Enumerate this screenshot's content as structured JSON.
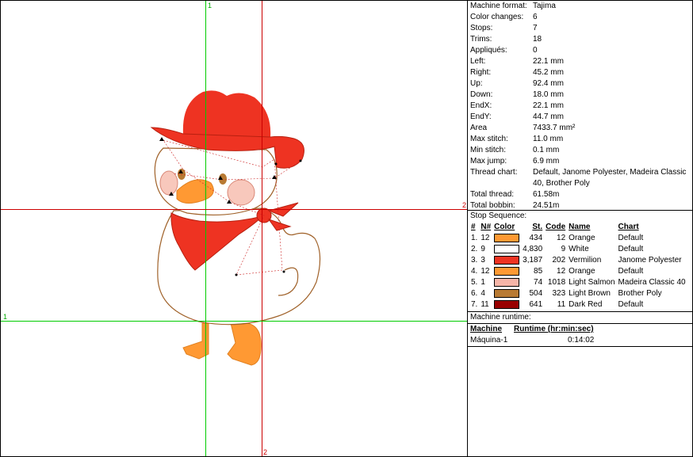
{
  "guides": {
    "v1_label": "1",
    "v2_label": "2",
    "h1_label": "1",
    "h2_label": "2"
  },
  "properties": [
    {
      "key": "Machine format:",
      "value": "Tajima"
    },
    {
      "key": "Color changes:",
      "value": "6"
    },
    {
      "key": "Stops:",
      "value": "7"
    },
    {
      "key": "Trims:",
      "value": "18"
    },
    {
      "key": "Appliqués:",
      "value": "0"
    },
    {
      "key": "Left:",
      "value": "22.1 mm"
    },
    {
      "key": "Right:",
      "value": "45.2 mm"
    },
    {
      "key": "Up:",
      "value": "92.4 mm"
    },
    {
      "key": "Down:",
      "value": "18.0 mm"
    },
    {
      "key": "EndX:",
      "value": "22.1 mm"
    },
    {
      "key": "EndY:",
      "value": "44.7 mm"
    },
    {
      "key": "Area",
      "value": "7433.7 mm²"
    },
    {
      "key": "Max stitch:",
      "value": "11.0 mm"
    },
    {
      "key": "Min stitch:",
      "value": "0.1 mm"
    },
    {
      "key": "Max jump:",
      "value": "6.9 mm"
    },
    {
      "key": "Thread chart:",
      "value": "Default, Janome Polyester, Madeira Classic 40, Brother Poly"
    },
    {
      "key": "Total thread:",
      "value": "61.58m"
    },
    {
      "key": "Total bobbin:",
      "value": "24.51m"
    }
  ],
  "stop_sequence": {
    "title": "Stop Sequence:",
    "headers": {
      "idx": "#",
      "n": "N#",
      "color": "Color",
      "st": "St.",
      "code": "Code",
      "name": "Name",
      "chart": "Chart"
    },
    "rows": [
      {
        "idx": "1.",
        "n": "12",
        "color": "#FF9933",
        "st": "434",
        "code": "12",
        "name": "Orange",
        "chart": "Default"
      },
      {
        "idx": "2.",
        "n": "9",
        "color": "#FFFFFF",
        "st": "4,830",
        "code": "9",
        "name": "White",
        "chart": "Default"
      },
      {
        "idx": "3.",
        "n": "3",
        "color": "#EE3322",
        "st": "3,187",
        "code": "202",
        "name": "Vermilion",
        "chart": "Janome Polyester"
      },
      {
        "idx": "4.",
        "n": "12",
        "color": "#FF9933",
        "st": "85",
        "code": "12",
        "name": "Orange",
        "chart": "Default"
      },
      {
        "idx": "5.",
        "n": "1",
        "color": "#F5B5A8",
        "st": "74",
        "code": "1018",
        "name": "Light Salmon",
        "chart": "Madeira Classic 40"
      },
      {
        "idx": "6.",
        "n": "4",
        "color": "#B87A33",
        "st": "504",
        "code": "323",
        "name": "Light Brown",
        "chart": "Brother Poly"
      },
      {
        "idx": "7.",
        "n": "11",
        "color": "#990000",
        "st": "641",
        "code": "11",
        "name": "Dark Red",
        "chart": "Default"
      }
    ]
  },
  "runtime": {
    "title": "Machine runtime:",
    "machine_header": "Machine",
    "runtime_header": "Runtime (hr:min:sec)",
    "rows": [
      {
        "machine": "Máquina-1",
        "runtime": "0:14:02"
      }
    ]
  },
  "colors": {
    "guide_green": "#00CC00",
    "guide_red": "#CC0000"
  },
  "design": {
    "icons": [
      "duck-body",
      "cowboy-hat",
      "bandana",
      "beak",
      "feet",
      "cheeks",
      "eyes"
    ]
  }
}
